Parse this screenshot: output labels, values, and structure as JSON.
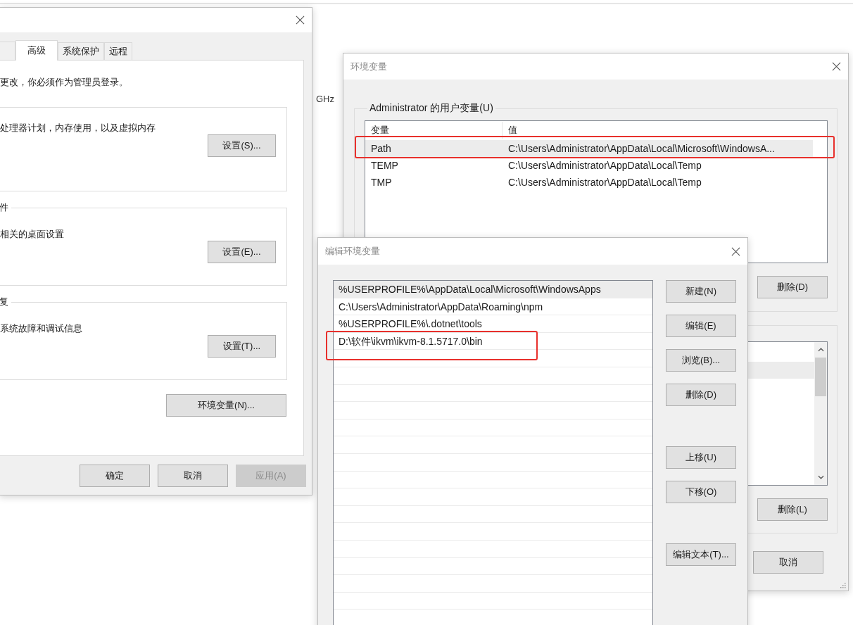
{
  "background_window": {
    "fragments": [
      "GHz"
    ]
  },
  "system_properties": {
    "tabs": [
      {
        "label": "高级",
        "selected": true
      },
      {
        "label": "系统保护",
        "selected": false
      },
      {
        "label": "远程",
        "selected": false
      }
    ],
    "notice": "更改，你必须作为管理员登录。",
    "groups": [
      {
        "description": "处理器计划，内存使用，以及虚拟内存",
        "button": "设置(S)..."
      },
      {
        "legend": "件",
        "description": "相关的桌面设置",
        "button": "设置(E)..."
      },
      {
        "legend": "复",
        "description": "系统故障和调试信息",
        "button": "设置(T)..."
      }
    ],
    "env_button": "环境变量(N)...",
    "buttons": [
      {
        "label": "确定",
        "disabled": false
      },
      {
        "label": "取消",
        "disabled": false
      },
      {
        "label": "应用(A)",
        "disabled": true
      }
    ]
  },
  "environment_variables": {
    "title": "环境变量",
    "user_group": {
      "legend": "Administrator 的用户变量(U)",
      "columns": [
        "变量",
        "值"
      ],
      "rows": [
        {
          "name": "Path",
          "value": "C:\\Users\\Administrator\\AppData\\Local\\Microsoft\\WindowsA...",
          "selected": true,
          "highlighted": true
        },
        {
          "name": "TEMP",
          "value": "C:\\Users\\Administrator\\AppData\\Local\\Temp",
          "selected": false,
          "highlighted": false
        },
        {
          "name": "TMP",
          "value": "C:\\Users\\Administrator\\AppData\\Local\\Temp",
          "selected": false,
          "highlighted": false
        }
      ],
      "button": "删除(D)"
    },
    "system_group": {
      "rows": [
        {
          "selected": false
        },
        {
          "selected": true
        }
      ],
      "button": "删除(L)"
    },
    "cancel": "取消"
  },
  "edit_dialog": {
    "title": "编辑环境变量",
    "entries": [
      {
        "text": "%USERPROFILE%\\AppData\\Local\\Microsoft\\WindowsApps",
        "selected": true,
        "highlighted": false
      },
      {
        "text": "C:\\Users\\Administrator\\AppData\\Roaming\\npm",
        "selected": false,
        "highlighted": false
      },
      {
        "text": "%USERPROFILE%\\.dotnet\\tools",
        "selected": false,
        "highlighted": false
      },
      {
        "text": "D:\\软件\\ikvm\\ikvm-8.1.5717.0\\bin",
        "selected": false,
        "highlighted": true
      }
    ],
    "buttons": [
      "新建(N)",
      "编辑(E)",
      "浏览(B)...",
      "删除(D)",
      "上移(U)",
      "下移(O)",
      "编辑文本(T)..."
    ]
  }
}
